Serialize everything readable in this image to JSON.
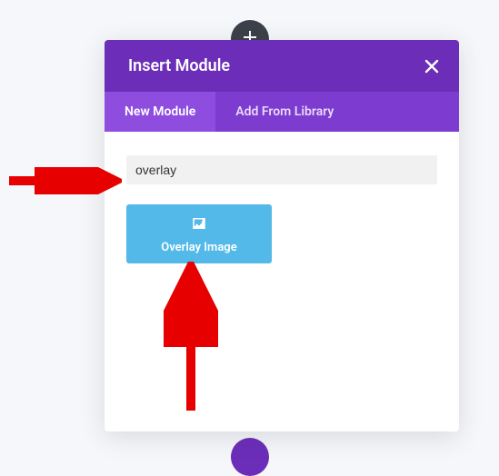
{
  "topButton": {
    "icon": "plus-icon"
  },
  "modal": {
    "title": "Insert Module",
    "closeIcon": "close-icon",
    "tabs": [
      {
        "label": "New Module",
        "active": true
      },
      {
        "label": "Add From Library",
        "active": false
      }
    ],
    "searchValue": "overlay",
    "modules": [
      {
        "label": "Overlay Image",
        "icon": "image-overlay-icon"
      }
    ]
  },
  "annotations": {
    "arrowColor": "#e60000"
  }
}
